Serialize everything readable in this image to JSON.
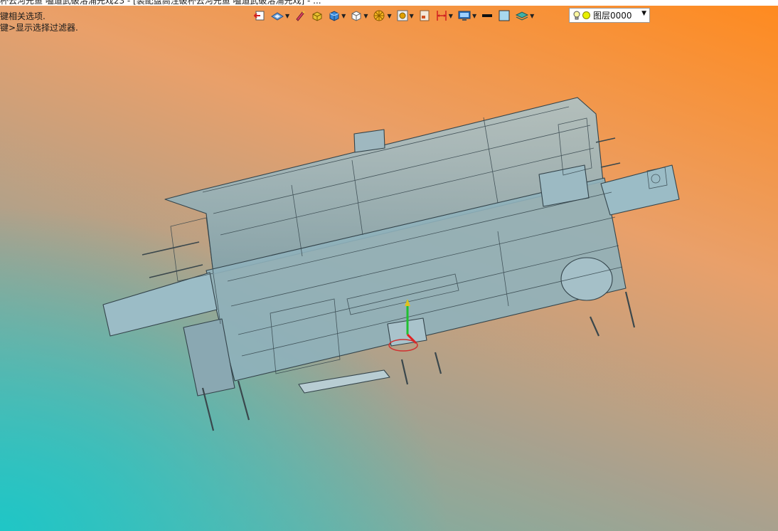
{
  "window": {
    "title": "杯云河先鱼 嗑道武破溶涌先戏23 - [装配盘高注破杯云河先鱼 嗑道武破溶涌先戏] - ..."
  },
  "hints": {
    "line1": "键相关选项.",
    "line2": "键>显示选择过滤器."
  },
  "toolbar": {
    "buttons": [
      {
        "name": "previous-view-icon"
      },
      {
        "name": "view-orientation-icon",
        "dropdown": true
      },
      {
        "name": "sketch-pencil-icon"
      },
      {
        "name": "display-style-icon"
      },
      {
        "name": "shaded-cube-icon",
        "dropdown": true
      },
      {
        "name": "wireframe-cube-icon",
        "dropdown": true
      },
      {
        "name": "section-view-icon",
        "dropdown": true
      },
      {
        "name": "appearance-icon",
        "dropdown": true
      },
      {
        "name": "sheet-icon"
      },
      {
        "name": "dimension-icon",
        "dropdown": true
      },
      {
        "name": "render-monitor-icon",
        "dropdown": true
      },
      {
        "name": "line-color-icon"
      },
      {
        "name": "fill-color-icon"
      },
      {
        "name": "layers-icon",
        "dropdown": true
      }
    ],
    "layer": {
      "icons": [
        "lightbulb-icon",
        "layer-on-icon"
      ],
      "value": "图层0000"
    }
  },
  "colors": {
    "bg_orange": "#ff8a1e",
    "bg_cyan": "#1fc6c6",
    "model_fill": "#8fb4bf",
    "model_edge": "#33434a"
  }
}
